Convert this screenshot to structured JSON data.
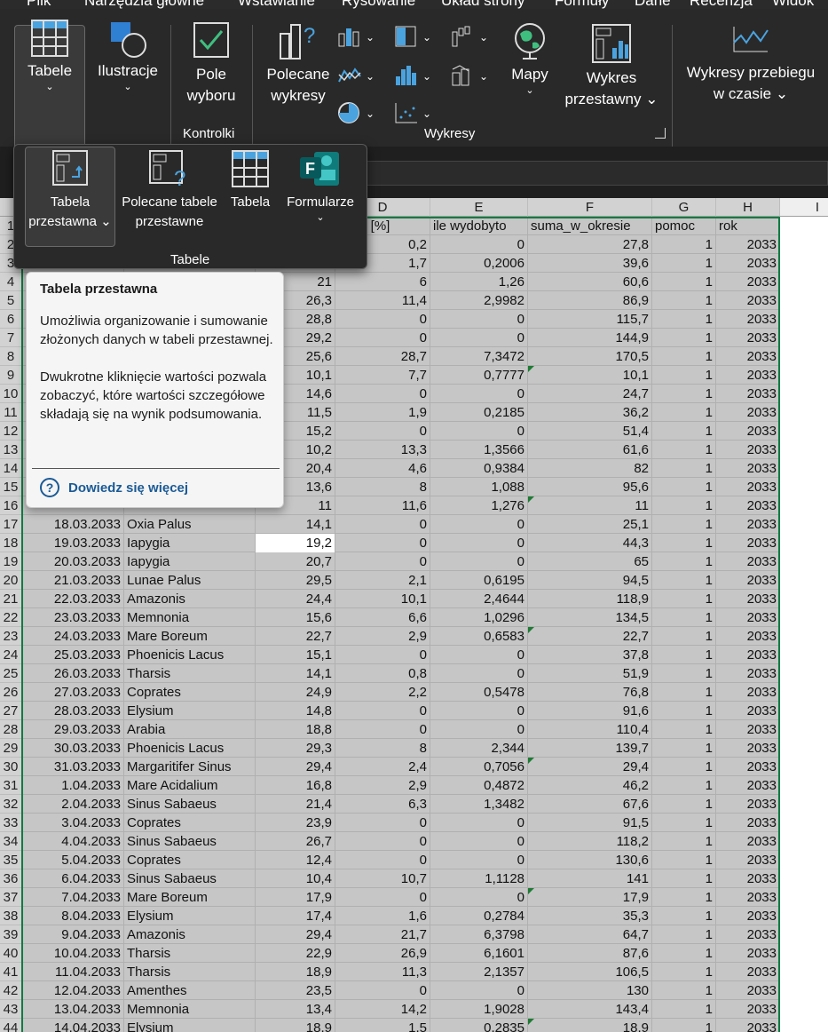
{
  "ribbon_tabs": [
    "Plik",
    "Narzędzia główne",
    "Wstawianie",
    "Rysowanie",
    "Układ strony",
    "Formuły",
    "Dane",
    "Recenzja",
    "Widok"
  ],
  "ribbon": {
    "tables": "Tabele",
    "illustrations": "Ilustracje",
    "checkbox_line1": "Pole",
    "checkbox_line2": "wyboru",
    "controls_group": "Kontrolki",
    "recommended_charts_line1": "Polecane",
    "recommended_charts_line2": "wykresy",
    "maps": "Mapy",
    "pivot_chart_line1": "Wykres",
    "pivot_chart_line2": "przestawny",
    "charts_group": "Wykresy",
    "sparklines_line1": "Wykresy przebiegu",
    "sparklines_line2": "w czasie"
  },
  "gallery": {
    "pivot_table_line1": "Tabela",
    "pivot_table_line2": "przestawna",
    "recommended_pivot_line1": "Polecane tabele",
    "recommended_pivot_line2": "przestawne",
    "table": "Tabela",
    "forms": "Formularze",
    "group_label": "Tabele"
  },
  "tooltip": {
    "title": "Tabela przestawna",
    "paragraph1": "Umożliwia organizowanie i sumowanie złożonych danych w tabeli przestawnej.",
    "paragraph2": "Dwukrotne kliknięcie wartości pozwala zobaczyć, które wartości szczegółowe składają się na wynik podsumowania.",
    "link": "Dowiedz się więcej"
  },
  "columns": [
    "D",
    "E",
    "F",
    "G",
    "H",
    "I"
  ],
  "header_row": {
    "d": "rtość [%]",
    "e": "ile wydobyto",
    "f": "suma_w_okresie",
    "g": "pomoc",
    "h": "rok"
  },
  "rows": [
    {
      "n": "2",
      "a": "",
      "b": "",
      "c": "",
      "d": "0,2",
      "e": "0",
      "f": "27,8",
      "g": "1",
      "h": "2033"
    },
    {
      "n": "3",
      "a": "",
      "b": "",
      "c": "",
      "d": "1,7",
      "e": "0,2006",
      "f": "39,6",
      "g": "1",
      "h": "2033"
    },
    {
      "n": "4",
      "a": "",
      "b": "",
      "c": "21",
      "d": "6",
      "e": "1,26",
      "f": "60,6",
      "g": "1",
      "h": "2033"
    },
    {
      "n": "5",
      "a": "",
      "b": "",
      "c": "26,3",
      "d": "11,4",
      "e": "2,9982",
      "f": "86,9",
      "g": "1",
      "h": "2033"
    },
    {
      "n": "6",
      "a": "",
      "b": "",
      "c": "28,8",
      "d": "0",
      "e": "0",
      "f": "115,7",
      "g": "1",
      "h": "2033"
    },
    {
      "n": "7",
      "a": "",
      "b": "",
      "c": "29,2",
      "d": "0",
      "e": "0",
      "f": "144,9",
      "g": "1",
      "h": "2033"
    },
    {
      "n": "8",
      "a": "",
      "b": "",
      "c": "25,6",
      "d": "28,7",
      "e": "7,3472",
      "f": "170,5",
      "g": "1",
      "h": "2033"
    },
    {
      "n": "9",
      "a": "",
      "b": "",
      "c": "10,1",
      "d": "7,7",
      "e": "0,7777",
      "f": "10,1",
      "g": "1",
      "h": "2033"
    },
    {
      "n": "10",
      "a": "",
      "b": "",
      "c": "14,6",
      "d": "0",
      "e": "0",
      "f": "24,7",
      "g": "1",
      "h": "2033"
    },
    {
      "n": "11",
      "a": "",
      "b": "",
      "c": "11,5",
      "d": "1,9",
      "e": "0,2185",
      "f": "36,2",
      "g": "1",
      "h": "2033"
    },
    {
      "n": "12",
      "a": "",
      "b": "",
      "c": "15,2",
      "d": "0",
      "e": "0",
      "f": "51,4",
      "g": "1",
      "h": "2033"
    },
    {
      "n": "13",
      "a": "",
      "b": "",
      "c": "10,2",
      "d": "13,3",
      "e": "1,3566",
      "f": "61,6",
      "g": "1",
      "h": "2033"
    },
    {
      "n": "14",
      "a": "",
      "b": "",
      "c": "20,4",
      "d": "4,6",
      "e": "0,9384",
      "f": "82",
      "g": "1",
      "h": "2033"
    },
    {
      "n": "15",
      "a": "",
      "b": "",
      "c": "13,6",
      "d": "8",
      "e": "1,088",
      "f": "95,6",
      "g": "1",
      "h": "2033"
    },
    {
      "n": "16",
      "a": "",
      "b": "",
      "c": "11",
      "d": "11,6",
      "e": "1,276",
      "f": "11",
      "g": "1",
      "h": "2033"
    },
    {
      "n": "17",
      "a": "18.03.2033",
      "b": "Oxia Palus",
      "c": "14,1",
      "d": "0",
      "e": "0",
      "f": "25,1",
      "g": "1",
      "h": "2033"
    },
    {
      "n": "18",
      "a": "19.03.2033",
      "b": "Iapygia",
      "c": "19,2",
      "d": "0",
      "e": "0",
      "f": "44,3",
      "g": "1",
      "h": "2033"
    },
    {
      "n": "19",
      "a": "20.03.2033",
      "b": "Iapygia",
      "c": "20,7",
      "d": "0",
      "e": "0",
      "f": "65",
      "g": "1",
      "h": "2033"
    },
    {
      "n": "20",
      "a": "21.03.2033",
      "b": "Lunae Palus",
      "c": "29,5",
      "d": "2,1",
      "e": "0,6195",
      "f": "94,5",
      "g": "1",
      "h": "2033"
    },
    {
      "n": "21",
      "a": "22.03.2033",
      "b": "Amazonis",
      "c": "24,4",
      "d": "10,1",
      "e": "2,4644",
      "f": "118,9",
      "g": "1",
      "h": "2033"
    },
    {
      "n": "22",
      "a": "23.03.2033",
      "b": "Memnonia",
      "c": "15,6",
      "d": "6,6",
      "e": "1,0296",
      "f": "134,5",
      "g": "1",
      "h": "2033"
    },
    {
      "n": "23",
      "a": "24.03.2033",
      "b": "Mare Boreum",
      "c": "22,7",
      "d": "2,9",
      "e": "0,6583",
      "f": "22,7",
      "g": "1",
      "h": "2033"
    },
    {
      "n": "24",
      "a": "25.03.2033",
      "b": "Phoenicis Lacus",
      "c": "15,1",
      "d": "0",
      "e": "0",
      "f": "37,8",
      "g": "1",
      "h": "2033"
    },
    {
      "n": "25",
      "a": "26.03.2033",
      "b": "Tharsis",
      "c": "14,1",
      "d": "0,8",
      "e": "0",
      "f": "51,9",
      "g": "1",
      "h": "2033"
    },
    {
      "n": "26",
      "a": "27.03.2033",
      "b": "Coprates",
      "c": "24,9",
      "d": "2,2",
      "e": "0,5478",
      "f": "76,8",
      "g": "1",
      "h": "2033"
    },
    {
      "n": "27",
      "a": "28.03.2033",
      "b": "Elysium",
      "c": "14,8",
      "d": "0",
      "e": "0",
      "f": "91,6",
      "g": "1",
      "h": "2033"
    },
    {
      "n": "28",
      "a": "29.03.2033",
      "b": "Arabia",
      "c": "18,8",
      "d": "0",
      "e": "0",
      "f": "110,4",
      "g": "1",
      "h": "2033"
    },
    {
      "n": "29",
      "a": "30.03.2033",
      "b": "Phoenicis Lacus",
      "c": "29,3",
      "d": "8",
      "e": "2,344",
      "f": "139,7",
      "g": "1",
      "h": "2033"
    },
    {
      "n": "30",
      "a": "31.03.2033",
      "b": "Margaritifer Sinus",
      "c": "29,4",
      "d": "2,4",
      "e": "0,7056",
      "f": "29,4",
      "g": "1",
      "h": "2033"
    },
    {
      "n": "31",
      "a": "1.04.2033",
      "b": "Mare Acidalium",
      "c": "16,8",
      "d": "2,9",
      "e": "0,4872",
      "f": "46,2",
      "g": "1",
      "h": "2033"
    },
    {
      "n": "32",
      "a": "2.04.2033",
      "b": "Sinus Sabaeus",
      "c": "21,4",
      "d": "6,3",
      "e": "1,3482",
      "f": "67,6",
      "g": "1",
      "h": "2033"
    },
    {
      "n": "33",
      "a": "3.04.2033",
      "b": "Coprates",
      "c": "23,9",
      "d": "0",
      "e": "0",
      "f": "91,5",
      "g": "1",
      "h": "2033"
    },
    {
      "n": "34",
      "a": "4.04.2033",
      "b": "Sinus Sabaeus",
      "c": "26,7",
      "d": "0",
      "e": "0",
      "f": "118,2",
      "g": "1",
      "h": "2033"
    },
    {
      "n": "35",
      "a": "5.04.2033",
      "b": "Coprates",
      "c": "12,4",
      "d": "0",
      "e": "0",
      "f": "130,6",
      "g": "1",
      "h": "2033"
    },
    {
      "n": "36",
      "a": "6.04.2033",
      "b": "Sinus Sabaeus",
      "c": "10,4",
      "d": "10,7",
      "e": "1,1128",
      "f": "141",
      "g": "1",
      "h": "2033"
    },
    {
      "n": "37",
      "a": "7.04.2033",
      "b": "Mare Boreum",
      "c": "17,9",
      "d": "0",
      "e": "0",
      "f": "17,9",
      "g": "1",
      "h": "2033"
    },
    {
      "n": "38",
      "a": "8.04.2033",
      "b": "Elysium",
      "c": "17,4",
      "d": "1,6",
      "e": "0,2784",
      "f": "35,3",
      "g": "1",
      "h": "2033"
    },
    {
      "n": "39",
      "a": "9.04.2033",
      "b": "Amazonis",
      "c": "29,4",
      "d": "21,7",
      "e": "6,3798",
      "f": "64,7",
      "g": "1",
      "h": "2033"
    },
    {
      "n": "40",
      "a": "10.04.2033",
      "b": "Tharsis",
      "c": "22,9",
      "d": "26,9",
      "e": "6,1601",
      "f": "87,6",
      "g": "1",
      "h": "2033"
    },
    {
      "n": "41",
      "a": "11.04.2033",
      "b": "Tharsis",
      "c": "18,9",
      "d": "11,3",
      "e": "2,1357",
      "f": "106,5",
      "g": "1",
      "h": "2033"
    },
    {
      "n": "42",
      "a": "12.04.2033",
      "b": "Amenthes",
      "c": "23,5",
      "d": "0",
      "e": "0",
      "f": "130",
      "g": "1",
      "h": "2033"
    },
    {
      "n": "43",
      "a": "13.04.2033",
      "b": "Memnonia",
      "c": "13,4",
      "d": "14,2",
      "e": "1,9028",
      "f": "143,4",
      "g": "1",
      "h": "2033"
    },
    {
      "n": "44",
      "a": "14.04.2033",
      "b": "Elysium",
      "c": "18,9",
      "d": "1,5",
      "e": "0,2835",
      "f": "18,9",
      "g": "1",
      "h": "2033"
    }
  ],
  "flagged_rows": [
    "9",
    "16",
    "23",
    "30",
    "37",
    "44"
  ]
}
